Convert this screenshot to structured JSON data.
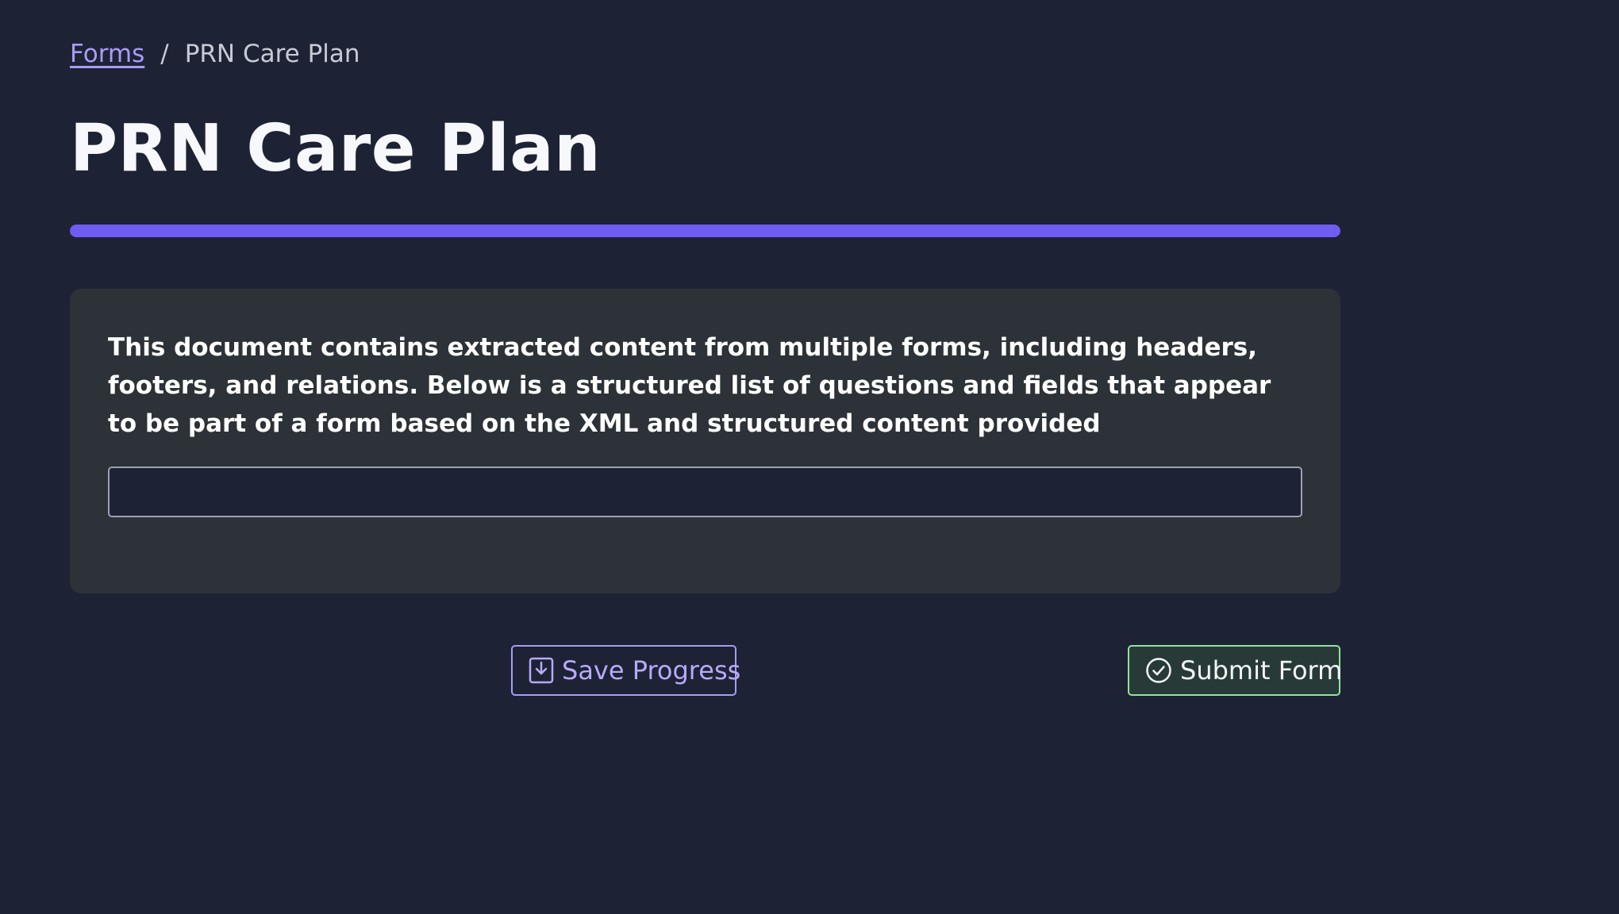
{
  "breadcrumb": {
    "link": "Forms",
    "separator": "/",
    "current": "PRN Care Plan"
  },
  "page_title": "PRN Care Plan",
  "progress": {
    "fraction": 1.0,
    "color": "#6f5cf2"
  },
  "question": {
    "text": "This document contains extracted content from multiple forms, including headers, footers, and relations. Below is a structured list of questions and fields that appear to be part of a form based on the XML and structured content provided",
    "answer_value": "",
    "answer_placeholder": ""
  },
  "actions": {
    "save_label": "Save Progress",
    "save_icon": "download-box-icon",
    "submit_label": "Submit Form",
    "submit_icon": "check-circle-icon"
  },
  "colors": {
    "background": "#1e2235",
    "card": "#2c3237",
    "accent": "#a89cf7",
    "success": "#8ee59a"
  }
}
